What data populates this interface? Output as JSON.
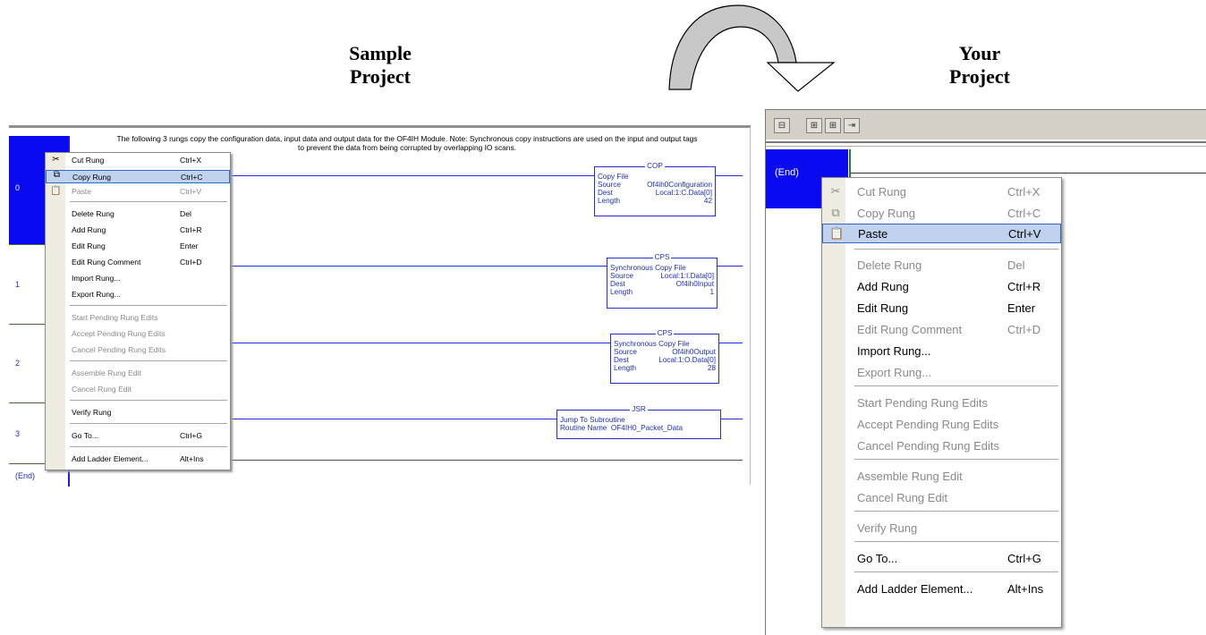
{
  "headings": {
    "left_line1": "Sample",
    "left_line2": "Project",
    "right_line1": "Your",
    "right_line2": "Project"
  },
  "left": {
    "comment_line1": "The following 3 rungs copy the configuration data, input data and output data for the OF4IH Module.  Note:  Synchronous copy instructions are used on the input and output tags",
    "comment_line2": "to prevent the data from being corrupted by overlapping IO scans.",
    "rungs": [
      "0",
      "1",
      "2",
      "3"
    ],
    "end_label": "(End)",
    "instructions": [
      {
        "mnemonic": "COP",
        "title": "Copy File",
        "source_label": "Source",
        "source": "Of4ih0Configuration",
        "dest_label": "Dest",
        "dest": "Local:1:C.Data[0]",
        "length_label": "Length",
        "length": "42"
      },
      {
        "mnemonic": "CPS",
        "title": "Synchronous Copy File",
        "source_label": "Source",
        "source": "Local:1:I.Data[0]",
        "dest_label": "Dest",
        "dest": "Of4ih0Input",
        "length_label": "Length",
        "length": "1"
      },
      {
        "mnemonic": "CPS",
        "title": "Synchronous Copy File",
        "source_label": "Source",
        "source": "Of4ih0Output",
        "dest_label": "Dest",
        "dest": "Local:1:O.Data[0]",
        "length_label": "Length",
        "length": "28"
      },
      {
        "mnemonic": "JSR",
        "title": "Jump To Subroutine",
        "routine_label": "Routine Name",
        "routine": "OF4IH0_Packet_Data"
      }
    ],
    "menu": [
      {
        "label": "Cut Rung",
        "key": "Ctrl+X",
        "icon": "scissors-icon"
      },
      {
        "label": "Copy Rung",
        "key": "Ctrl+C",
        "icon": "copy-icon"
      },
      {
        "label": "Paste",
        "key": "Ctrl+V",
        "icon": "paste-icon"
      },
      {
        "label": "Delete Rung",
        "key": "Del"
      },
      {
        "label": "Add Rung",
        "key": "Ctrl+R"
      },
      {
        "label": "Edit Rung",
        "key": "Enter"
      },
      {
        "label": "Edit Rung Comment",
        "key": "Ctrl+D"
      },
      {
        "label": "Import Rung...",
        "key": ""
      },
      {
        "label": "Export Rung...",
        "key": ""
      },
      {
        "label": "Start Pending Rung Edits",
        "key": ""
      },
      {
        "label": "Accept Pending Rung Edits",
        "key": ""
      },
      {
        "label": "Cancel Pending Rung Edits",
        "key": ""
      },
      {
        "label": "Assemble Rung Edit",
        "key": ""
      },
      {
        "label": "Cancel Rung Edit",
        "key": ""
      },
      {
        "label": "Verify Rung",
        "key": ""
      },
      {
        "label": "Go To...",
        "key": "Ctrl+G"
      },
      {
        "label": "Add Ladder Element...",
        "key": "Alt+Ins"
      }
    ]
  },
  "right": {
    "end_label": "(End)",
    "toolbar_icons": [
      "rung-icon",
      "branch-icon",
      "branch-level-icon",
      "output-icon"
    ],
    "menu": [
      {
        "label": "Cut Rung",
        "key": "Ctrl+X",
        "icon": "scissors-icon"
      },
      {
        "label": "Copy Rung",
        "key": "Ctrl+C",
        "icon": "copy-icon"
      },
      {
        "label": "Paste",
        "key": "Ctrl+V",
        "icon": "paste-icon"
      },
      {
        "label": "Delete Rung",
        "key": "Del"
      },
      {
        "label": "Add Rung",
        "key": "Ctrl+R"
      },
      {
        "label": "Edit Rung",
        "key": "Enter"
      },
      {
        "label": "Edit Rung Comment",
        "key": "Ctrl+D"
      },
      {
        "label": "Import Rung...",
        "key": ""
      },
      {
        "label": "Export Rung...",
        "key": ""
      },
      {
        "label": "Start Pending Rung Edits",
        "key": ""
      },
      {
        "label": "Accept Pending Rung Edits",
        "key": ""
      },
      {
        "label": "Cancel Pending Rung Edits",
        "key": ""
      },
      {
        "label": "Assemble Rung Edit",
        "key": ""
      },
      {
        "label": "Cancel Rung Edit",
        "key": ""
      },
      {
        "label": "Verify Rung",
        "key": ""
      },
      {
        "label": "Go To...",
        "key": "Ctrl+G"
      },
      {
        "label": "Add Ladder Element...",
        "key": "Alt+Ins"
      }
    ]
  },
  "colors": {
    "rung_selected": "#0a0af0",
    "wire": "#1a2fe0",
    "menu_highlight": "#c1d2ee",
    "menu_highlight_border": "#316ac5",
    "toolbar": "#d4d0c8"
  }
}
